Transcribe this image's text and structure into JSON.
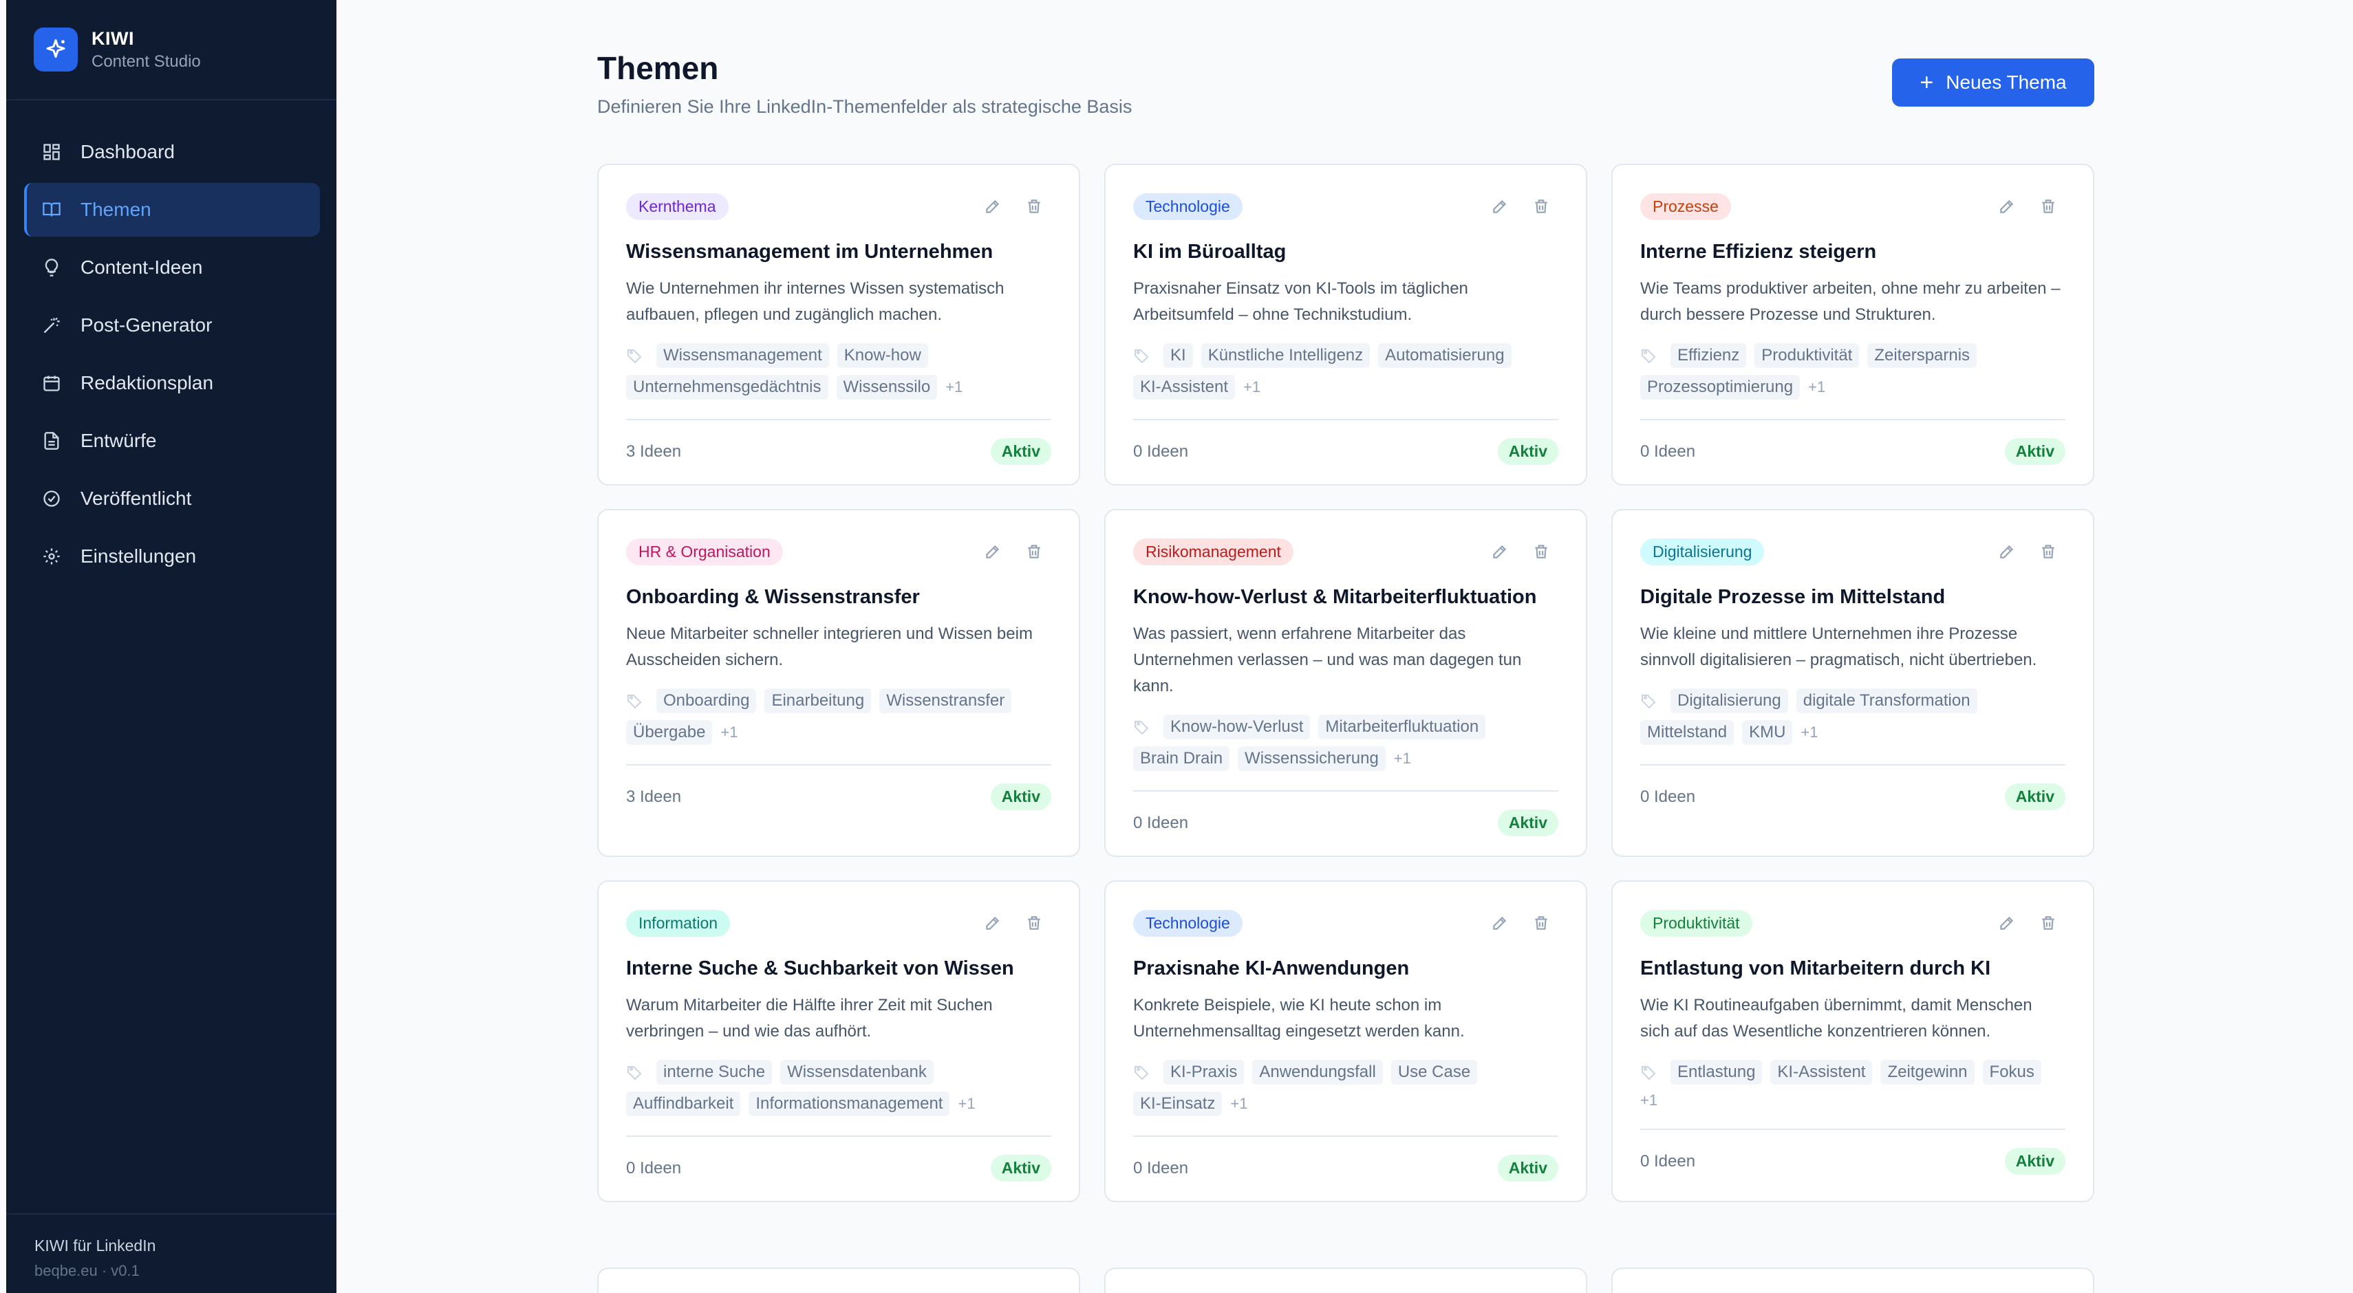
{
  "brand": {
    "name": "KIWI",
    "subtitle": "Content Studio"
  },
  "nav": {
    "items": [
      {
        "label": "Dashboard",
        "icon": "dashboard-icon"
      },
      {
        "label": "Themen",
        "icon": "book-icon",
        "active": true
      },
      {
        "label": "Content-Ideen",
        "icon": "lightbulb-icon"
      },
      {
        "label": "Post-Generator",
        "icon": "wand-icon"
      },
      {
        "label": "Redaktionsplan",
        "icon": "calendar-icon"
      },
      {
        "label": "Entwürfe",
        "icon": "document-icon"
      },
      {
        "label": "Veröffentlicht",
        "icon": "check-circle-icon"
      },
      {
        "label": "Einstellungen",
        "icon": "gear-icon"
      }
    ]
  },
  "footer": {
    "title": "KIWI für LinkedIn",
    "subtitle": "beqbe.eu · v0.1"
  },
  "header": {
    "title": "Themen",
    "subtitle": "Definieren Sie Ihre LinkedIn-Themenfelder als strategische Basis",
    "new_button": "Neues Thema"
  },
  "colors": {
    "accent": "#2563eb",
    "sidebar_bg": "#0f1b30",
    "status_active": "#15803d"
  },
  "cards": [
    {
      "badge": "Kernthema",
      "badge_color": "#6d28d9",
      "badge_bg": "#ede9fe",
      "title": "Wissensmanagement im Unternehmen",
      "description": "Wie Unternehmen ihr internes Wissen systematisch aufbauen, pflegen und zugänglich machen.",
      "tags": [
        "Wissensmanagement",
        "Know-how",
        "Unternehmensgedächtnis",
        "Wissenssilo"
      ],
      "more": "+1",
      "ideas": "3 Ideen",
      "status": "Aktiv"
    },
    {
      "badge": "Technologie",
      "badge_color": "#1d4ed8",
      "badge_bg": "#dbeafe",
      "title": "KI im Büroalltag",
      "description": "Praxisnaher Einsatz von KI-Tools im täglichen Arbeitsumfeld – ohne Technikstudium.",
      "tags": [
        "KI",
        "Künstliche Intelligenz",
        "Automatisierung",
        "KI-Assistent"
      ],
      "more": "+1",
      "ideas": "0 Ideen",
      "status": "Aktiv"
    },
    {
      "badge": "Prozesse",
      "badge_color": "#c2410c",
      "badge_bg": "#ffe4e6",
      "title": "Interne Effizienz steigern",
      "description": "Wie Teams produktiver arbeiten, ohne mehr zu arbeiten – durch bessere Prozesse und Strukturen.",
      "tags": [
        "Effizienz",
        "Produktivität",
        "Zeitersparnis",
        "Prozessoptimierung"
      ],
      "more": "+1",
      "ideas": "0 Ideen",
      "status": "Aktiv"
    },
    {
      "badge": "HR & Organisation",
      "badge_color": "#be185d",
      "badge_bg": "#fce7f3",
      "title": "Onboarding & Wissenstransfer",
      "description": "Neue Mitarbeiter schneller integrieren und Wissen beim Ausscheiden sichern.",
      "tags": [
        "Onboarding",
        "Einarbeitung",
        "Wissenstransfer",
        "Übergabe"
      ],
      "more": "+1",
      "ideas": "3 Ideen",
      "status": "Aktiv"
    },
    {
      "badge": "Risikomanagement",
      "badge_color": "#b91c1c",
      "badge_bg": "#fee2e2",
      "title": "Know-how-Verlust & Mitarbeiterfluktuation",
      "description": "Was passiert, wenn erfahrene Mitarbeiter das Unternehmen verlassen – und was man dagegen tun kann.",
      "tags": [
        "Know-how-Verlust",
        "Mitarbeiterfluktuation",
        "Brain Drain",
        "Wissenssicherung"
      ],
      "more": "+1",
      "ideas": "0 Ideen",
      "status": "Aktiv"
    },
    {
      "badge": "Digitalisierung",
      "badge_color": "#0e7490",
      "badge_bg": "#cffafe",
      "title": "Digitale Prozesse im Mittelstand",
      "description": "Wie kleine und mittlere Unternehmen ihre Prozesse sinnvoll digitalisieren – pragmatisch, nicht übertrieben.",
      "tags": [
        "Digitalisierung",
        "digitale Transformation",
        "Mittelstand",
        "KMU"
      ],
      "more": "+1",
      "ideas": "0 Ideen",
      "status": "Aktiv"
    },
    {
      "badge": "Information",
      "badge_color": "#0f766e",
      "badge_bg": "#ccfbf1",
      "title": "Interne Suche & Suchbarkeit von Wissen",
      "description": "Warum Mitarbeiter die Hälfte ihrer Zeit mit Suchen verbringen – und wie das aufhört.",
      "tags": [
        "interne Suche",
        "Wissensdatenbank",
        "Auffindbarkeit",
        "Informationsmanagement"
      ],
      "more": "+1",
      "ideas": "0 Ideen",
      "status": "Aktiv"
    },
    {
      "badge": "Technologie",
      "badge_color": "#1d4ed8",
      "badge_bg": "#dbeafe",
      "title": "Praxisnahe KI-Anwendungen",
      "description": "Konkrete Beispiele, wie KI heute schon im Unternehmensalltag eingesetzt werden kann.",
      "tags": [
        "KI-Praxis",
        "Anwendungsfall",
        "Use Case",
        "KI-Einsatz"
      ],
      "more": "+1",
      "ideas": "0 Ideen",
      "status": "Aktiv"
    },
    {
      "badge": "Produktivität",
      "badge_color": "#15803d",
      "badge_bg": "#dcfce7",
      "title": "Entlastung von Mitarbeitern durch KI",
      "description": "Wie KI Routineaufgaben übernimmt, damit Menschen sich auf das Wesentliche konzentrieren können.",
      "tags": [
        "Entlastung",
        "KI-Assistent",
        "Zeitgewinn",
        "Fokus"
      ],
      "more": "+1",
      "ideas": "0 Ideen",
      "status": "Aktiv"
    }
  ]
}
